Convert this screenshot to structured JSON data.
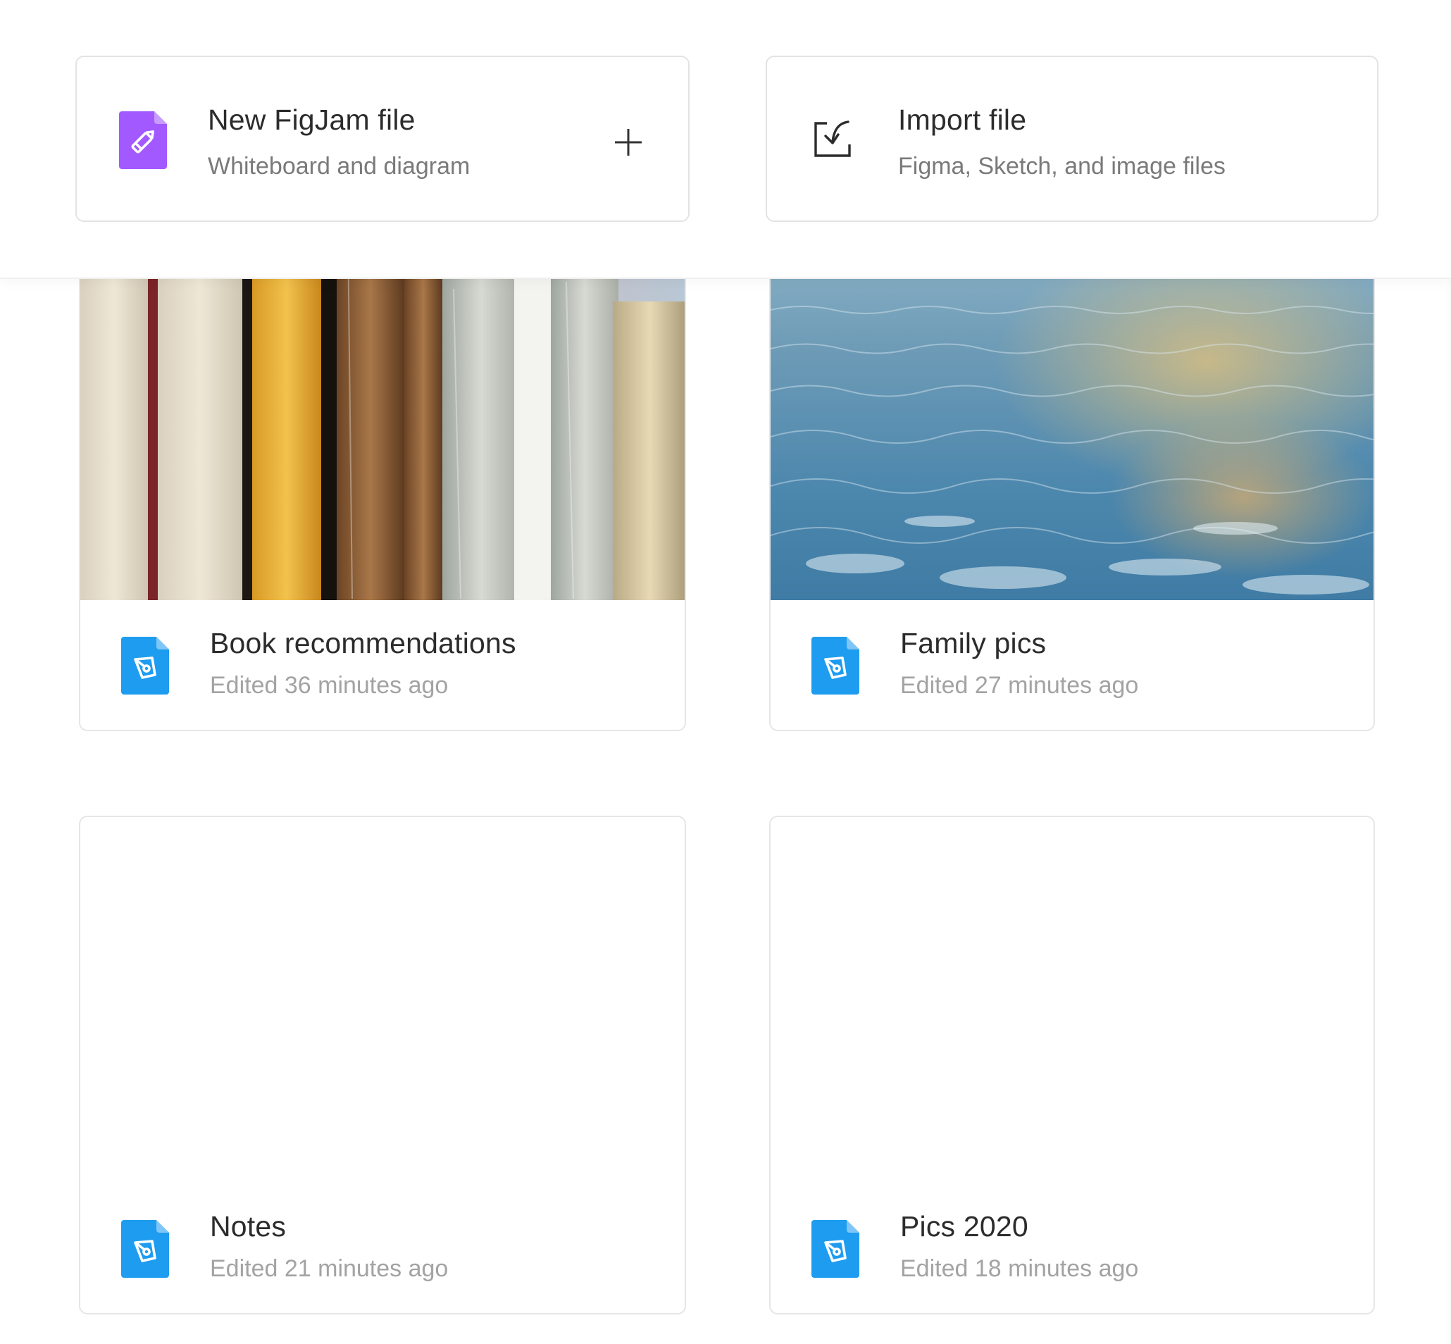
{
  "actions": {
    "new_file": {
      "title": "New FigJam file",
      "subtitle": "Whiteboard and diagram",
      "icon": "figjam-file-icon",
      "plus_icon": "plus-icon",
      "color": "#a259ff"
    },
    "import_file": {
      "title": "Import file",
      "subtitle": "Figma, Sketch, and image files",
      "icon": "import-icon"
    }
  },
  "files": [
    {
      "name": "Book recommendations",
      "edited": "Edited 36 minutes ago",
      "thumbnail": "books-photo",
      "icon": "figma-file-icon"
    },
    {
      "name": "Family pics",
      "edited": "Edited 27 minutes ago",
      "thumbnail": "ocean-photo",
      "icon": "figma-file-icon"
    },
    {
      "name": "Notes",
      "edited": "Edited 21 minutes ago",
      "thumbnail": "blank",
      "icon": "figma-file-icon"
    },
    {
      "name": "Pics 2020",
      "edited": "Edited 18 minutes ago",
      "thumbnail": "blank",
      "icon": "figma-file-icon"
    }
  ],
  "colors": {
    "file_icon": "#1e9cf0",
    "figjam_icon": "#a259ff",
    "card_border": "#e3e3e3",
    "subtitle": "#7a7a7a",
    "meta": "#a3a3a3"
  }
}
